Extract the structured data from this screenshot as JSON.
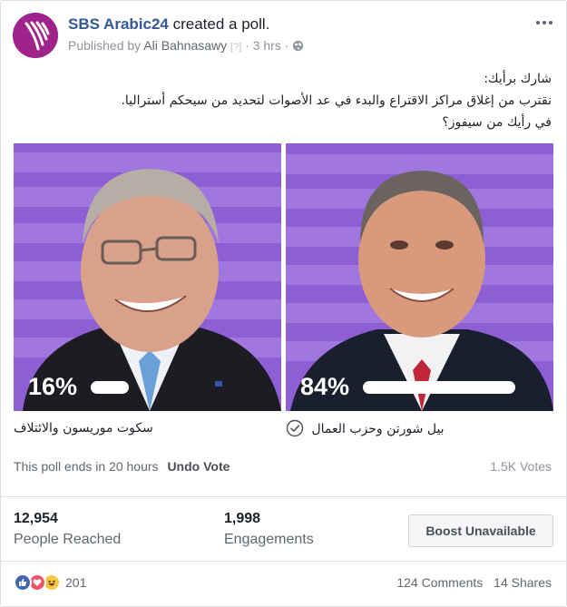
{
  "header": {
    "page_name": "SBS Arabic24",
    "action": " created a poll.",
    "published_by": "Published by ",
    "author": "Ali Bahnasawy",
    "help": "[?]",
    "time": "· 3 hrs ·",
    "avatar_icon": "sbs-logo-icon",
    "brand_color": "#a0238c"
  },
  "post": {
    "line1": "شارك برأيك:",
    "line2": "نقترب من إغلاق مراكز الاقتراع والبدء في عد الأصوات لتحديد من سيحكم أستراليا.",
    "line3": "في رأيك من سيفوز؟"
  },
  "poll": {
    "options": [
      {
        "percent_label": "16%",
        "percent": 16,
        "label": "سكوت موريسون والائتلاف",
        "selected": false
      },
      {
        "percent_label": "84%",
        "percent": 84,
        "label": "بيل شورتن وحزب العمال",
        "selected": true
      }
    ],
    "ends_text": "This poll ends in 20 hours",
    "undo_label": "Undo Vote",
    "votes": "1.5K Votes",
    "photo_bg_color": "#8e5fd4"
  },
  "insights": {
    "reached_value": "12,954",
    "reached_label": "People Reached",
    "engagements_value": "1,998",
    "engagements_label": "Engagements",
    "boost_label": "Boost Unavailable"
  },
  "footer": {
    "reaction_icons": [
      "like-icon",
      "love-icon",
      "haha-icon"
    ],
    "reaction_count": "201",
    "comments": "124 Comments",
    "shares": "14 Shares"
  }
}
